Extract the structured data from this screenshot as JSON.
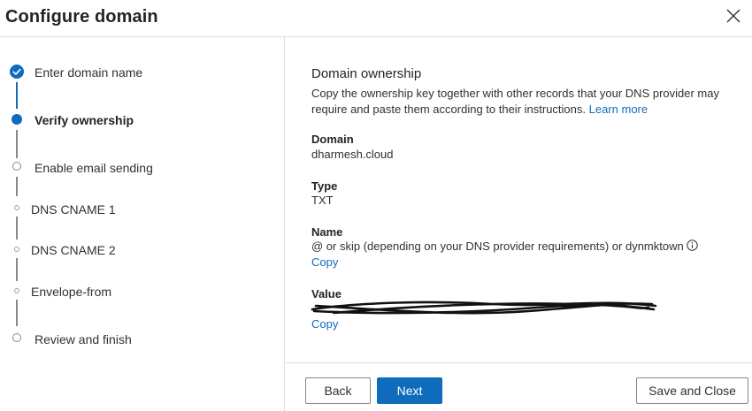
{
  "header": {
    "title": "Configure domain",
    "close_icon": "close-icon"
  },
  "steps": [
    {
      "label": "Enter domain name",
      "state": "completed"
    },
    {
      "label": "Verify ownership",
      "state": "current"
    },
    {
      "label": "Enable email sending",
      "state": "pending"
    },
    {
      "label": "DNS CNAME 1",
      "state": "pending-substep"
    },
    {
      "label": "DNS CNAME 2",
      "state": "pending-substep"
    },
    {
      "label": "Envelope-from",
      "state": "pending-substep"
    },
    {
      "label": "Review and finish",
      "state": "pending"
    }
  ],
  "content": {
    "title": "Domain ownership",
    "description": "Copy the ownership key together with other records that your DNS provider may require and paste them according to their instructions.",
    "learn_more": "Learn more",
    "fields": {
      "domain": {
        "label": "Domain",
        "value": "dharmesh.cloud"
      },
      "type": {
        "label": "Type",
        "value": "TXT"
      },
      "name": {
        "label": "Name",
        "value": "@ or skip (depending on your DNS provider requirements) or dynmktown",
        "copy": "Copy"
      },
      "value": {
        "label": "Value",
        "copy": "Copy"
      }
    }
  },
  "footer": {
    "back_label": "Back",
    "next_label": "Next",
    "save_close_label": "Save and Close"
  },
  "colors": {
    "accent": "#0f6cbd",
    "border": "#e1dfdd",
    "text": "#323130"
  }
}
